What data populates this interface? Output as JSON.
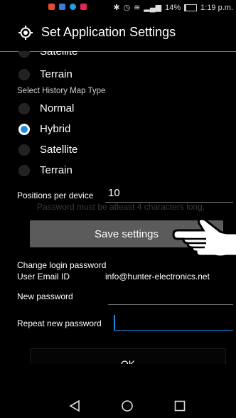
{
  "status_bar": {
    "percent": "14%",
    "time": "1:19 p.m."
  },
  "app_bar": {
    "title": "Set Application Settings",
    "icon": "locator-icon"
  },
  "map_type_top": {
    "options": [
      {
        "label": "Satellite",
        "selected": false
      },
      {
        "label": "Terrain",
        "selected": false
      }
    ]
  },
  "history_map": {
    "label": "Select History Map Type",
    "options": [
      {
        "label": "Normal",
        "selected": false
      },
      {
        "label": "Hybrid",
        "selected": true
      },
      {
        "label": "Satellite",
        "selected": false
      },
      {
        "label": "Terrain",
        "selected": false
      }
    ]
  },
  "positions": {
    "label": "Positions per device",
    "value": "10",
    "hint": "Password must be atleast 4 characters long."
  },
  "save_button": "Save settings",
  "password": {
    "change_label": "Change login password",
    "email_label": "User Email ID",
    "email_value": "info@hunter-electronics.net",
    "new_label": "New password",
    "repeat_label": "Repeat new password",
    "new_value": "",
    "repeat_value": ""
  },
  "ok_button": "OK",
  "colors": {
    "accent": "#1e8be0",
    "button": "#5b5b5b"
  },
  "nav": {
    "back_icon": "back-icon",
    "home_icon": "home-icon",
    "recents_icon": "recents-icon"
  }
}
